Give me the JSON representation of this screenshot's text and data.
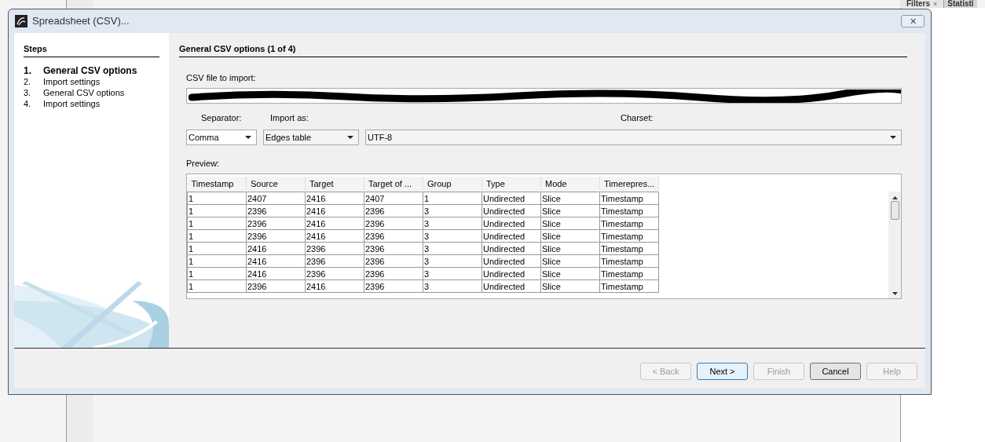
{
  "background_tabs": [
    {
      "label": "Filters",
      "close": "×",
      "selected": true
    },
    {
      "label": "Statisti",
      "selected": false
    }
  ],
  "window": {
    "title": "Spreadsheet (CSV)...",
    "close": "✕"
  },
  "steps": {
    "heading": "Steps",
    "items": [
      {
        "number": "1.",
        "label": "General CSV options",
        "selected": true
      },
      {
        "number": "2.",
        "label": "Import settings",
        "selected": false
      },
      {
        "number": "3.",
        "label": "General CSV options",
        "selected": false
      },
      {
        "number": "4.",
        "label": "Import settings",
        "selected": false
      }
    ]
  },
  "panel": {
    "title": "General CSV options (1 of 4)",
    "file": {
      "label": "CSV file to import:",
      "redacted": true
    },
    "separator": {
      "label": "Separator:",
      "value": "Comma"
    },
    "import_as": {
      "label": "Import as:",
      "value": "Edges table"
    },
    "charset": {
      "label": "Charset:",
      "value": "UTF-8"
    },
    "preview": {
      "label": "Preview:",
      "columns": [
        "Timestamp",
        "Source",
        "Target",
        "Target of ...",
        "Group",
        "Type",
        "Mode",
        "Timerepres..."
      ],
      "rows": [
        [
          "1",
          "2407",
          "2416",
          "2407",
          "1",
          "Undirected",
          "Slice",
          "Timestamp"
        ],
        [
          "1",
          "2396",
          "2416",
          "2396",
          "3",
          "Undirected",
          "Slice",
          "Timestamp"
        ],
        [
          "1",
          "2396",
          "2416",
          "2396",
          "3",
          "Undirected",
          "Slice",
          "Timestamp"
        ],
        [
          "1",
          "2396",
          "2416",
          "2396",
          "3",
          "Undirected",
          "Slice",
          "Timestamp"
        ],
        [
          "1",
          "2416",
          "2396",
          "2396",
          "3",
          "Undirected",
          "Slice",
          "Timestamp"
        ],
        [
          "1",
          "2416",
          "2396",
          "2396",
          "3",
          "Undirected",
          "Slice",
          "Timestamp"
        ],
        [
          "1",
          "2416",
          "2396",
          "2396",
          "3",
          "Undirected",
          "Slice",
          "Timestamp"
        ],
        [
          "1",
          "2396",
          "2416",
          "2396",
          "3",
          "Undirected",
          "Slice",
          "Timestamp"
        ]
      ]
    }
  },
  "buttons": [
    {
      "label": "< Back",
      "disabled": true,
      "focused": false
    },
    {
      "label": "Next >",
      "disabled": false,
      "focused": true
    },
    {
      "label": "Finish",
      "disabled": true,
      "focused": false
    },
    {
      "label": "Cancel",
      "disabled": false,
      "focused": false
    },
    {
      "label": "Help",
      "disabled": true,
      "focused": false
    }
  ]
}
